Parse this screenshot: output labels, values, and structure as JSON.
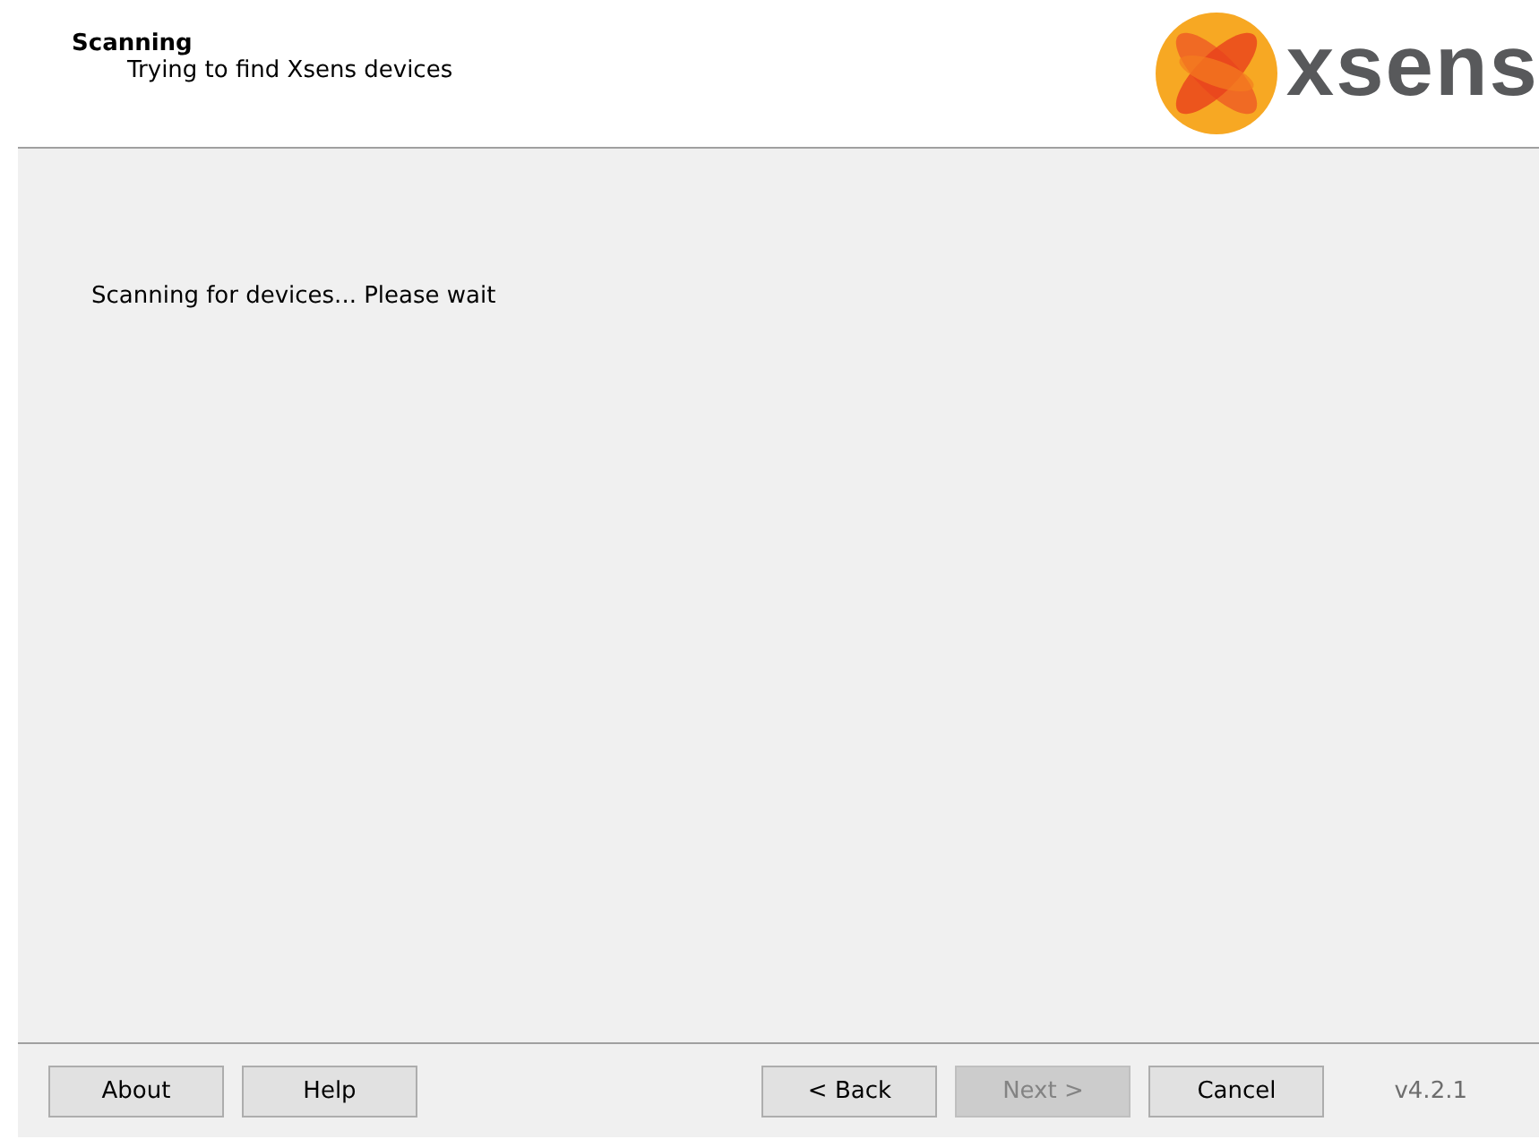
{
  "header": {
    "title": "Scanning",
    "subtitle": "Trying to find Xsens devices",
    "logo_text": "xsens"
  },
  "body": {
    "message": "Scanning for devices... Please wait"
  },
  "footer": {
    "left_buttons": [
      {
        "label": "About",
        "disabled": false
      },
      {
        "label": "Help",
        "disabled": false
      }
    ],
    "right_buttons": [
      {
        "label": "< Back",
        "disabled": false
      },
      {
        "label": "Next >",
        "disabled": true
      },
      {
        "label": "Cancel",
        "disabled": false
      }
    ],
    "version": "v4.2.1"
  }
}
